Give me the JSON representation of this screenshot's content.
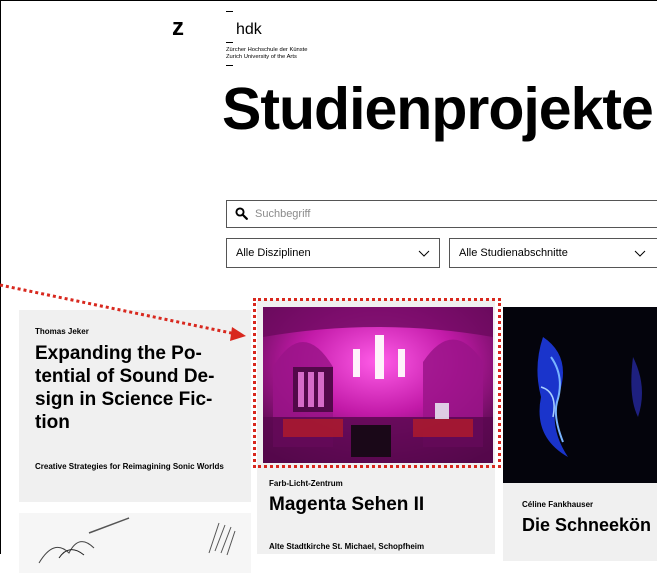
{
  "header": {
    "logo_letter": "z",
    "logo_word": "hdk",
    "university_de": "Zürcher Hochschule der Künste",
    "university_en": "Zurich University of the Arts"
  },
  "page_title": "Studienprojekte",
  "search": {
    "placeholder": "Suchbegriff"
  },
  "filters": {
    "discipline": "Alle Disziplinen",
    "study_stage": "Alle Studienabschnitte"
  },
  "colors": {
    "highlight": "#d8281e",
    "card_bg": "#f0f0f0"
  },
  "cards": [
    {
      "author": "Thomas Jeker",
      "title": "Expanding the Po-tential of Sound De-sign in Science Fic-tion",
      "subtitle": "Creative Strategies for Reimagining Sonic Worlds"
    },
    {
      "author": "Farb-Licht-Zentrum",
      "title": "Magenta Sehen II",
      "subtitle": "Alte Stadtkirche St. Michael, Schopfheim"
    },
    {
      "author": "Céline Fankhauser",
      "title": "Die Schneekön"
    }
  ]
}
